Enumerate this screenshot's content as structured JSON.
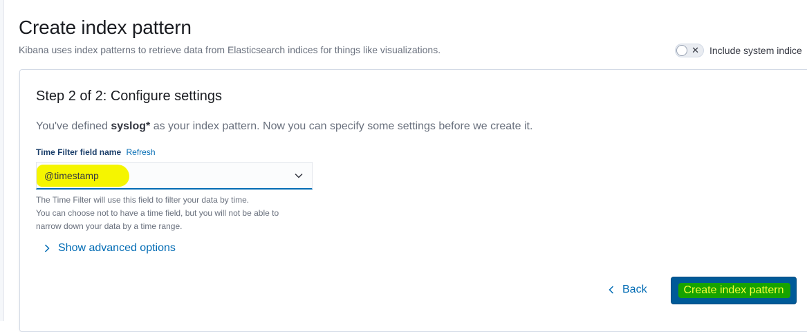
{
  "header": {
    "title": "Create index pattern",
    "description": "Kibana uses index patterns to retrieve data from Elasticsearch indices for things like visualizations.",
    "system_toggle": {
      "label": "Include system indice",
      "checked": false
    }
  },
  "step": {
    "title": "Step 2 of 2: Configure settings",
    "desc_prefix": "You've defined ",
    "pattern": "syslog*",
    "desc_suffix": " as your index pattern. Now you can specify some settings before we create it."
  },
  "time_field": {
    "label": "Time Filter field name",
    "refresh": "Refresh",
    "value": "@timestamp",
    "help": [
      "The Time Filter will use this field to filter your data by time.",
      "You can choose not to have a time field, but you will not be able to",
      "narrow down your data by a time range."
    ]
  },
  "advanced": {
    "label": "Show advanced options"
  },
  "footer": {
    "back_label": "Back",
    "create_label": "Create index pattern"
  },
  "colors": {
    "accent": "#006bb4",
    "primary_button": "#005a98",
    "highlight_yellow": "#f5f500",
    "highlight_green": "#16a300"
  },
  "icons": {
    "toggle": "x-icon",
    "select": "chevron-down-icon",
    "advanced": "chevron-right-icon",
    "back": "chevron-left-icon"
  }
}
